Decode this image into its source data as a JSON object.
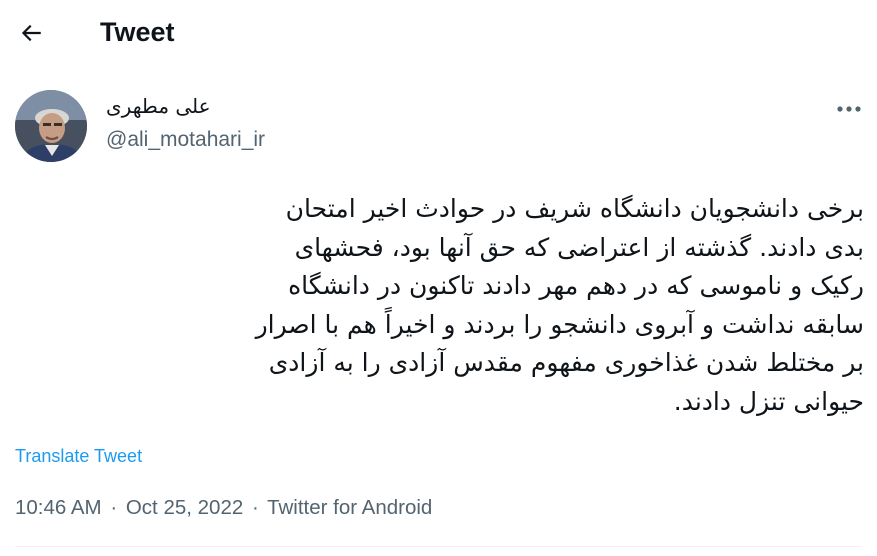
{
  "header": {
    "title": "Tweet",
    "back_icon": "arrow-left-icon"
  },
  "author": {
    "display_name": "علی مطهری",
    "handle": "@ali_motahari_ir"
  },
  "tweet": {
    "lines": [
      "برخی دانشجویان دانشگاه شریف در حوادث اخیر امتحان",
      "بدی دادند. گذشته از اعتراضی که حق آنها بود، فحشهای",
      "رکیک و ناموسی که در دهم مهر دادند تاکنون در دانشگاه",
      "سابقه نداشت و آبروی دانشجو را بردند و اخیراً هم با اصرار",
      "بر مختلط شدن غذاخوری مفهوم مقدس آزادی را به آزادی",
      "حیوانی تنزل دادند."
    ],
    "translate_label": "Translate Tweet"
  },
  "meta": {
    "time": "10:46 AM",
    "separator": "·",
    "date": "Oct 25, 2022",
    "source": "Twitter for Android"
  },
  "colors": {
    "text": "#0f1419",
    "secondary": "#536471",
    "link": "#1d9bf0",
    "divider": "#eff3f4"
  }
}
